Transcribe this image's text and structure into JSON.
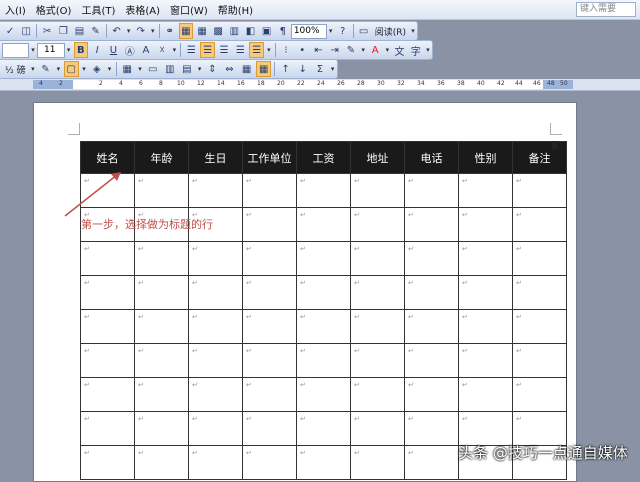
{
  "menubar": {
    "items": [
      "入(I)",
      "格式(O)",
      "工具(T)",
      "表格(A)",
      "窗口(W)",
      "帮助(H)"
    ],
    "help_placeholder": "键入需要"
  },
  "toolbar": {
    "zoom": "100%",
    "read_label": "阅读(R)",
    "font_size": "11",
    "bold": "B",
    "italic": "I",
    "underline": "U",
    "line_spacing_label": "½ 磅"
  },
  "ruler": {
    "numbers": [
      "4",
      "2",
      "2",
      "4",
      "6",
      "8",
      "10",
      "12",
      "14",
      "16",
      "18",
      "20",
      "22",
      "24",
      "26",
      "28",
      "30",
      "32",
      "34",
      "36",
      "38",
      "40",
      "42",
      "44",
      "46",
      "48",
      "50"
    ]
  },
  "table": {
    "headers": [
      "姓名",
      "年龄",
      "生日",
      "工作单位",
      "工资",
      "地址",
      "电话",
      "性别",
      "备注"
    ],
    "cell_mark": "↵"
  },
  "annotation": "第一步，选择做为标题的行",
  "watermark": "头条 @技巧一点通自媒体"
}
